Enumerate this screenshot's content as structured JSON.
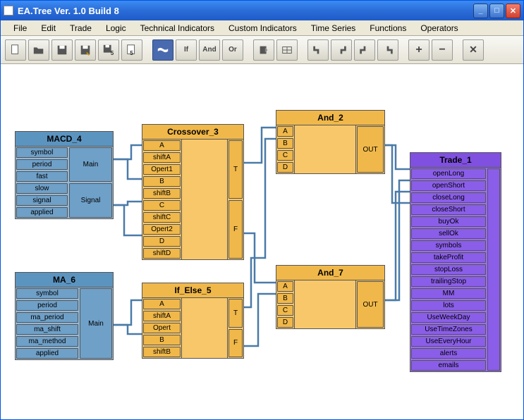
{
  "window": {
    "title": "EA.Tree Ver. 1.0 Build 8"
  },
  "menu": [
    "File",
    "Edit",
    "Trade",
    "Logic",
    "Technical Indicators",
    "Custom Indicators",
    "Time Series",
    "Functions",
    "Operators"
  ],
  "toolbar": {
    "new": "new",
    "open": "open",
    "save": "save",
    "saveas": "saveas",
    "save5": "5",
    "page5": "5",
    "world": "world",
    "if": "If",
    "and": "And",
    "or": "Or",
    "block1": "b1",
    "block2": "b2",
    "j1": "j1",
    "j2": "j2",
    "j3": "j3",
    "j4": "j4",
    "plus": "+",
    "minus": "−",
    "close": "✕"
  },
  "nodes": {
    "macd4": {
      "title": "MACD_4",
      "ports": [
        "symbol",
        "period",
        "fast",
        "slow",
        "signal",
        "applied"
      ],
      "outs": [
        "Main",
        "Signal"
      ]
    },
    "ma6": {
      "title": "MA_6",
      "ports": [
        "symbol",
        "period",
        "ma_period",
        "ma_shift",
        "ma_method",
        "applied"
      ],
      "outs": [
        "Main"
      ]
    },
    "crossover3": {
      "title": "Crossover_3",
      "ports": [
        "A",
        "shiftA",
        "Opert1",
        "B",
        "shiftB",
        "C",
        "shiftC",
        "Opert2",
        "D",
        "shiftD"
      ],
      "outs": [
        "T",
        "F"
      ]
    },
    "ifelse5": {
      "title": "If_Else_5",
      "ports": [
        "A",
        "shiftA",
        "Opert",
        "B",
        "shiftB"
      ],
      "outs": [
        "T",
        "F"
      ]
    },
    "and2": {
      "title": "And_2",
      "ports": [
        "A",
        "B",
        "C",
        "D"
      ],
      "outs": [
        "OUT"
      ]
    },
    "and7": {
      "title": "And_7",
      "ports": [
        "A",
        "B",
        "C",
        "D"
      ],
      "outs": [
        "OUT"
      ]
    },
    "trade1": {
      "title": "Trade_1",
      "ports": [
        "openLong",
        "openShort",
        "closeLong",
        "closeShort",
        "buyOk",
        "sellOk",
        "symbols",
        "takeProfit",
        "stopLoss",
        "trailingStop",
        "MM",
        "lots",
        "UseWeekDay",
        "UseTimeZones",
        "UseEveryHour",
        "alerts",
        "emails"
      ]
    }
  }
}
